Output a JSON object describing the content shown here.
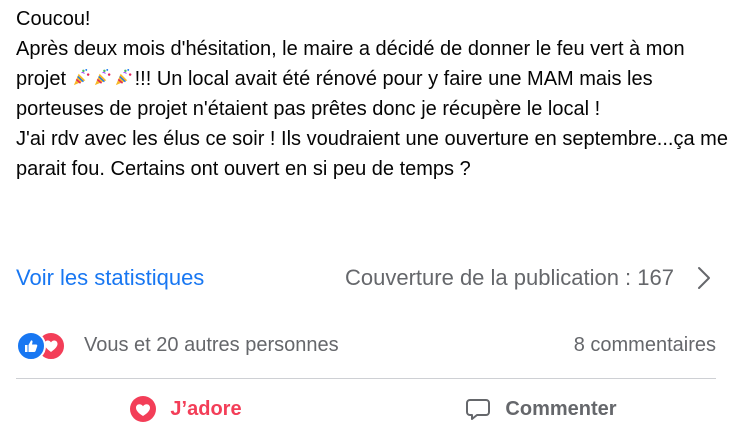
{
  "post": {
    "line1": "Coucou!",
    "line2_before_emoji": "Après deux mois d'hésitation, le maire a décidé de donner le feu vert à mon projet ",
    "emoji": [
      "party-popper-icon",
      "party-popper-icon",
      "party-popper-icon"
    ],
    "line2_after_emoji": "!!! Un local avait été rénové pour y faire une MAM mais les porteuses de projet n'étaient pas prêtes donc je récupère le local !",
    "line3": "J'ai rdv avec les élus ce soir ! Ils voudraient une ouverture en septembre...ça me parait fou. Certains ont ouvert en si peu de temps ?"
  },
  "stats": {
    "link_label": "Voir les statistiques",
    "reach_label": "Couverture de la publication : 167"
  },
  "reactions": {
    "names": "Vous et 20 autres personnes",
    "comments": "8 commentaires",
    "icons": [
      "like-icon",
      "love-icon"
    ]
  },
  "actions": {
    "love_label": "J’adore",
    "comment_label": "Commenter"
  },
  "colors": {
    "link": "#1877f2",
    "secondary_text": "#65676b",
    "love": "#f33e58",
    "like": "#1877f2",
    "divider": "#ced0d4"
  }
}
